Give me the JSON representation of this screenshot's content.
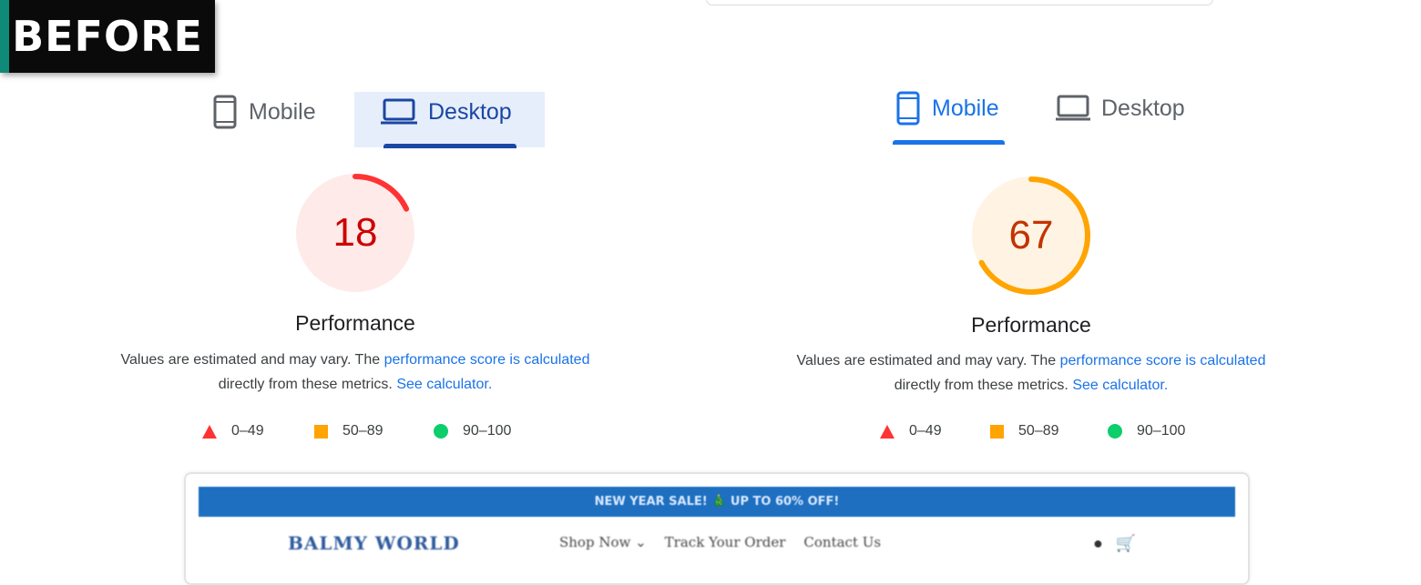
{
  "badge": {
    "label": "BEFORE"
  },
  "colors": {
    "fail": "#ff3333",
    "average": "#ffa400",
    "pass": "#0cce6b",
    "link": "#1a73e8"
  },
  "left_panel": {
    "tabs": [
      {
        "label": "Mobile",
        "icon": "mobile-phone-icon",
        "active": false
      },
      {
        "label": "Desktop",
        "icon": "laptop-icon",
        "active": true
      }
    ],
    "score": 18,
    "score_fraction": 0.18,
    "title": "Performance",
    "desc_prefix": "Values are estimated and may vary. The",
    "desc_link1": "performance score is calculated",
    "desc_middle": "directly from these metrics.",
    "desc_link2": "See calculator.",
    "legend": [
      "0–49",
      "50–89",
      "90–100"
    ]
  },
  "right_panel": {
    "tabs": [
      {
        "label": "Mobile",
        "icon": "mobile-phone-icon",
        "active": true
      },
      {
        "label": "Desktop",
        "icon": "laptop-icon",
        "active": false
      }
    ],
    "score": 67,
    "score_fraction": 0.67,
    "title": "Performance",
    "desc_prefix": "Values are estimated and may vary. The",
    "desc_link1": "performance score is calculated",
    "desc_middle": "directly from these metrics.",
    "desc_link2": "See calculator.",
    "legend": [
      "0–49",
      "50–89",
      "90–100"
    ]
  },
  "preview": {
    "promo": "NEW YEAR SALE! 🎄 UP TO 60% OFF!",
    "logo": "BALMY WORLD",
    "nav": [
      "Shop Now ⌄",
      "Track Your Order",
      "Contact Us"
    ],
    "icons": [
      "globe-icon",
      "cart-icon"
    ]
  }
}
